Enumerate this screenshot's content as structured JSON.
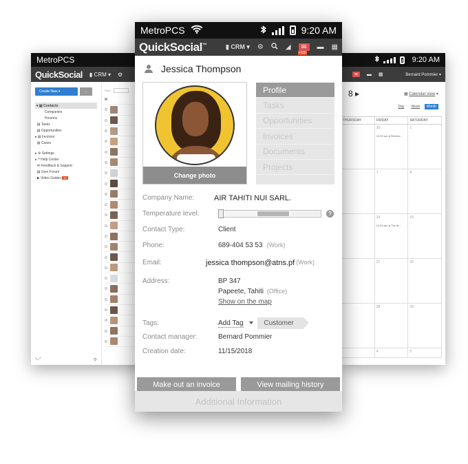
{
  "left": {
    "carrier": "MetroPCS",
    "logo": "QuickSocial",
    "crm": "CRM",
    "create_new": "Create New",
    "more": "...",
    "filter": "Filter",
    "nav": {
      "contacts": "Contacts",
      "companies": "Companies",
      "persons": "Persons",
      "tasks": "Tasks",
      "opportunities": "Opportunities",
      "invoices": "Invoices",
      "cases": "Cases",
      "settings": "Settings",
      "help_center": "Help Center",
      "feedback": "Feedback & Support",
      "user_forum": "User Forum",
      "video_guides": "Video Guides",
      "video_badge": "10"
    }
  },
  "right": {
    "time": "9:20 AM",
    "manager": "Bernard Pommier",
    "calendar_view": "Calendar view",
    "views": [
      "Day",
      "Week",
      "Month"
    ],
    "days": [
      "THURSDAY",
      "FRIDAY",
      "SATURDAY"
    ],
    "weeks": [
      [
        "",
        "30",
        "1"
      ],
      [
        "",
        "7",
        "8"
      ],
      [
        "",
        "14",
        "15"
      ],
      [
        "",
        "21",
        "22"
      ],
      [
        "",
        "28",
        "29"
      ],
      [
        "",
        "4",
        "5"
      ]
    ],
    "events": {
      "fri_wk1": "10:00 am ● Review...",
      "fri_wk3": "10:00 am ● The Ar..."
    }
  },
  "center": {
    "carrier": "MetroPCS",
    "time": "9:20 AM",
    "logo": "QuickSocial",
    "crm": "CRM",
    "mail_count": "+100",
    "contact_name": "Jessica Thompson",
    "change_photo": "Change photo",
    "tabs": [
      "Profile",
      "Tasks",
      "Opportunities",
      "Invoices",
      "Documents",
      "Projects"
    ],
    "fields": {
      "company_label": "Company Name:",
      "company_value": "AIR TAHITI NUI SARL.",
      "temperature_label": "Temperature level:",
      "contact_type_label": "Contact Type:",
      "contact_type_value": "Client",
      "phone_label": "Phone:",
      "phone_value": "689-404 53 53",
      "phone_type": "(Work)",
      "email_label": "Email:",
      "email_value": "jessica thompson@atns.pf",
      "email_type": "(Work)",
      "address_label": "Address:",
      "address_line1": "BP 347",
      "address_line2": "Papeete, Tahiti",
      "address_type": "(Office)",
      "show_map": "Show on the map",
      "tags_label": "Tags:",
      "add_tag": "Add Tag",
      "tag_customer": "Customer",
      "manager_label": "Contact manager:",
      "manager_value": "Bernard Pommier",
      "created_label": "Creation date:",
      "created_value": "11/15/2018"
    },
    "buttons": {
      "invoice": "Make out an invoice",
      "mailing": "View mailing history"
    },
    "additional": "Additional Information"
  }
}
